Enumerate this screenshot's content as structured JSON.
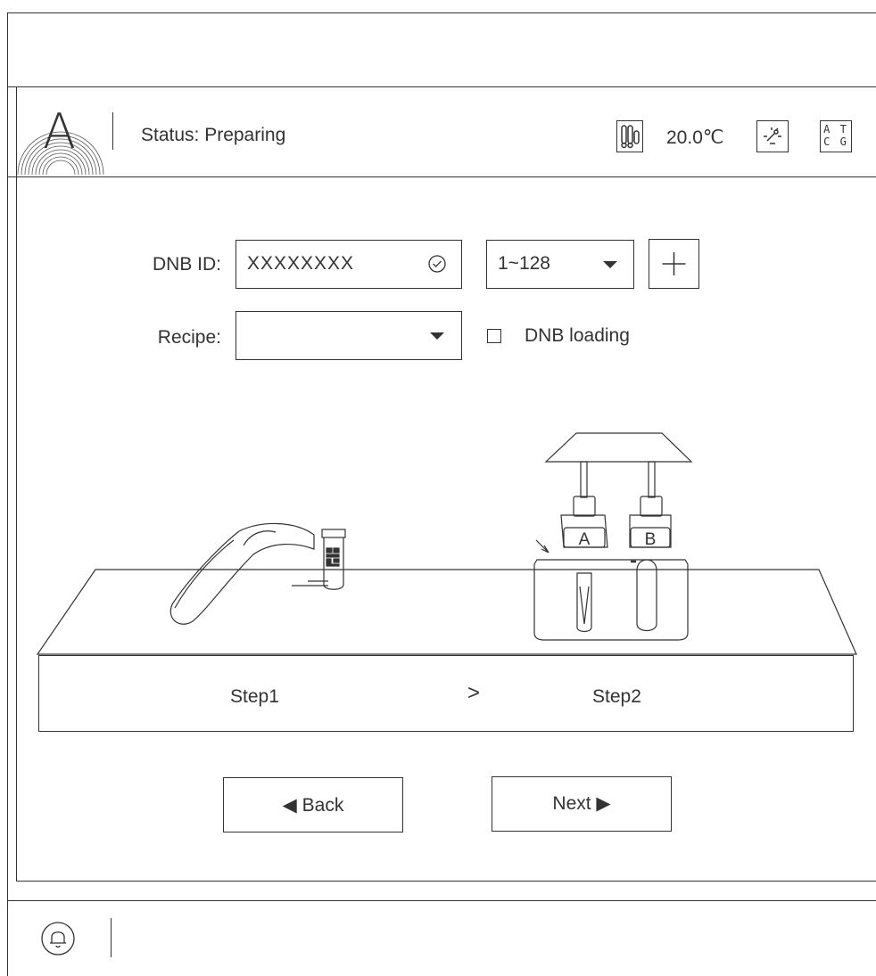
{
  "header": {
    "logo_letter": "A",
    "status": "Status: Preparing",
    "temperature": "20.0℃",
    "sequencer_icon_text": "A T\nC G"
  },
  "form": {
    "dnb_label": "DNB ID:",
    "dnb_value": "XXXXXXXX",
    "range_value": "1~128",
    "recipe_label": "Recipe:",
    "recipe_value": "",
    "dnb_loading_label": "DNB loading",
    "dnb_loading_checked": false
  },
  "illustration": {
    "reagent_a": "A",
    "reagent_b": "B"
  },
  "steps": {
    "step1": "Step1",
    "separator": ">",
    "step2": "Step2"
  },
  "nav": {
    "back_label": "◀ Back",
    "next_label": "Next ▶"
  },
  "icons": {
    "temperature": "temperature-icon",
    "plugin": "plugin-icon",
    "sequence": "atcg-icon",
    "bell": "bell-icon",
    "add": "plus-icon"
  }
}
